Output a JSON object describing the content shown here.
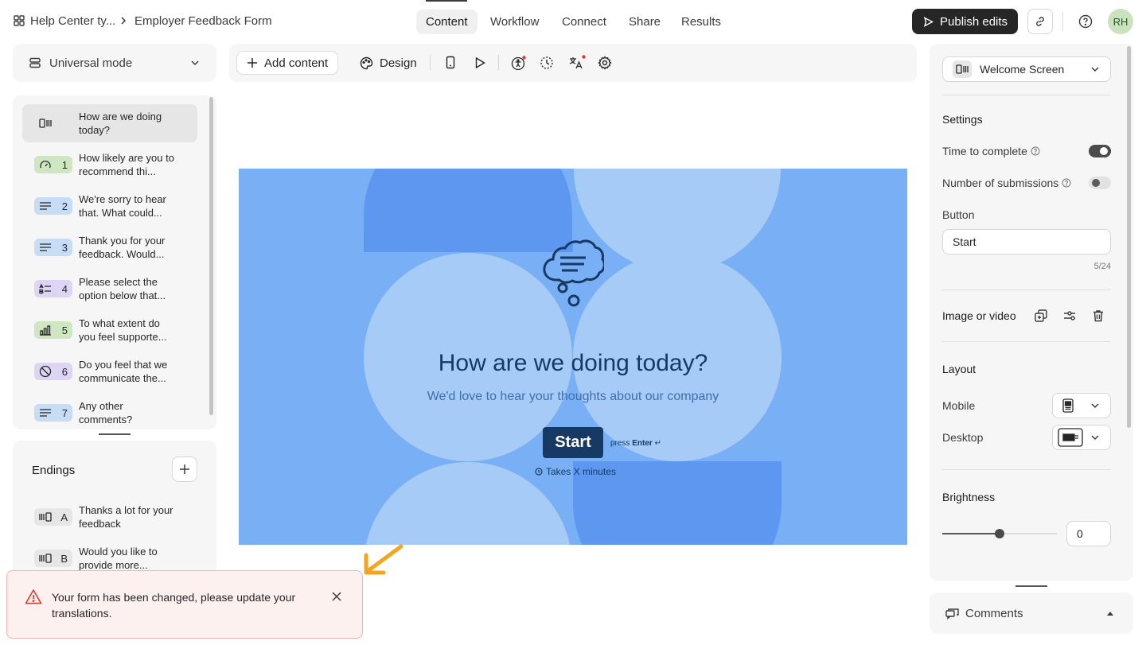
{
  "breadcrumb": {
    "workspace": "Help Center ty...",
    "form": "Employer Feedback Form"
  },
  "nav_tabs": [
    {
      "label": "Content",
      "active": true
    },
    {
      "label": "Workflow",
      "active": false
    },
    {
      "label": "Connect",
      "active": false
    },
    {
      "label": "Share",
      "active": false
    },
    {
      "label": "Results",
      "active": false
    }
  ],
  "header": {
    "publish_label": "Publish edits",
    "avatar_initials": "RH"
  },
  "mode": {
    "label": "Universal mode"
  },
  "questions": [
    {
      "badge": "",
      "text": "How are we doing today?",
      "color": "#e6e6e6",
      "icon": "welcome-screen-icon",
      "selected": true
    },
    {
      "badge": "1",
      "text": "How likely are you to recommend thi...",
      "color": "#cfe6c3",
      "icon": "gauge-icon"
    },
    {
      "badge": "2",
      "text": "We're sorry to hear that. What could...",
      "color": "#c7ddf6",
      "icon": "long-text-icon"
    },
    {
      "badge": "3",
      "text": "Thank you for your feedback. Would...",
      "color": "#c7ddf6",
      "icon": "long-text-icon"
    },
    {
      "badge": "4",
      "text": "Please select the option below that...",
      "color": "#ddd5f3",
      "icon": "multiple-choice-icon"
    },
    {
      "badge": "5",
      "text": "To what extent do you feel supporte...",
      "color": "#cfe6c3",
      "icon": "bar-chart-icon"
    },
    {
      "badge": "6",
      "text": "Do you feel that we communicate the...",
      "color": "#ddd5f3",
      "icon": "yes-no-icon"
    },
    {
      "badge": "7",
      "text": "Any other comments?",
      "color": "#c7ddf6",
      "icon": "long-text-icon"
    }
  ],
  "endings": {
    "title": "Endings",
    "items": [
      {
        "badge": "A",
        "text": "Thanks a lot for your feedback"
      },
      {
        "badge": "B",
        "text": "Would you like to provide more..."
      }
    ]
  },
  "toolbar": {
    "add_content": "Add content",
    "design": "Design"
  },
  "preview": {
    "title": "How are we doing today?",
    "subtitle": "We'd love to hear your thoughts about our company",
    "button": "Start",
    "press": "press",
    "enter": "Enter",
    "enter_symbol": "↵",
    "time": "Takes X minutes"
  },
  "right_panel": {
    "block_type": "Welcome Screen",
    "settings_title": "Settings",
    "time_to_complete": "Time to complete",
    "time_to_complete_on": true,
    "submissions": "Number of submissions",
    "submissions_on": false,
    "button_label": "Button",
    "button_value": "Start",
    "counter": "5/24",
    "image_or_video": "Image or video",
    "layout": "Layout",
    "mobile": "Mobile",
    "desktop": "Desktop",
    "brightness": "Brightness",
    "brightness_value": "0",
    "brightness_fraction": 0.5
  },
  "toast": {
    "message": "Your form has been changed, please update your translations."
  },
  "comments": {
    "label": "Comments"
  },
  "colors": {
    "canvas_bg": "#79aff4",
    "shape_light": "#a6cbf6",
    "shape_dark": "#5e97f0",
    "start_button": "#163a64",
    "accent_red": "#d83a2b",
    "highlight_arrow": "#f3a51f"
  }
}
